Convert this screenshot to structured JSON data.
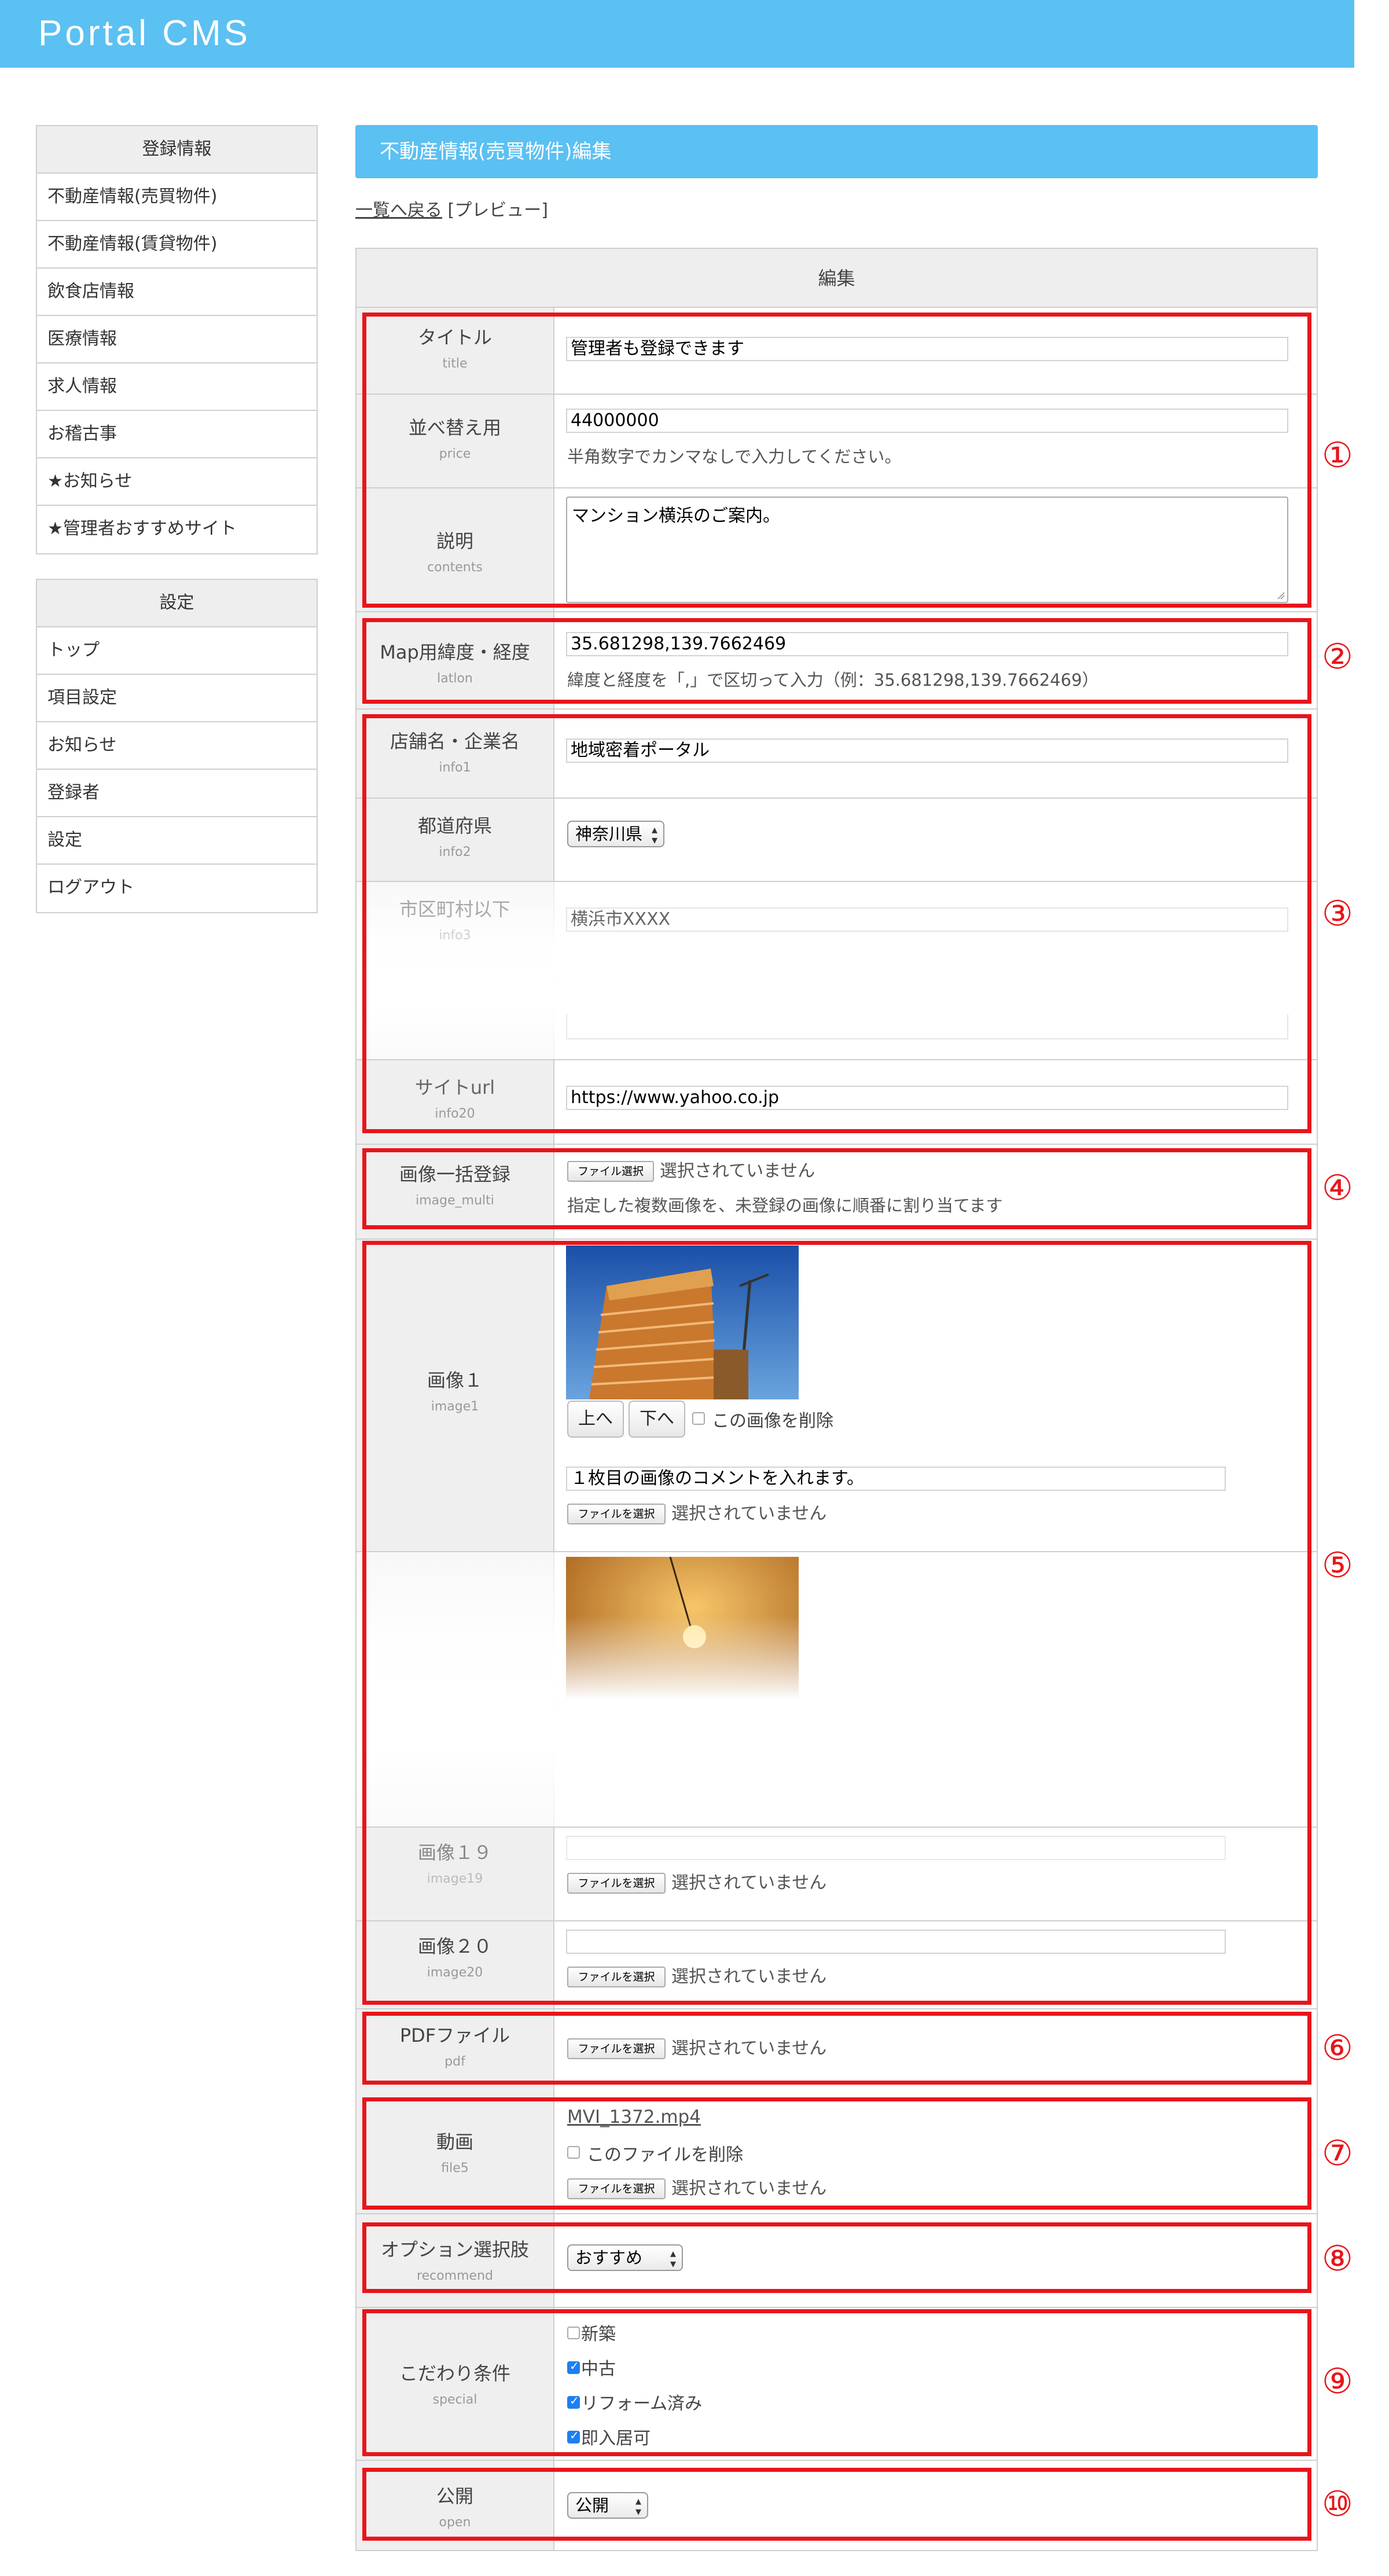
{
  "app": {
    "brand": "Portal CMS"
  },
  "sidebar": {
    "registration": {
      "title": "登録情報",
      "items": [
        "不動産情報(売買物件)",
        "不動産情報(賃貸物件)",
        "飲食店情報",
        "医療情報",
        "求人情報",
        "お稽古事",
        "★お知らせ",
        "★管理者おすすめサイト"
      ]
    },
    "settings": {
      "title": "設定",
      "items": [
        "トップ",
        "項目設定",
        "お知らせ",
        "登録者",
        "設定",
        "ログアウト"
      ]
    }
  },
  "page": {
    "header": "不動産情報(売買物件)編集",
    "back_link": "一覧へ戻る",
    "preview_link": "[プレビュー]",
    "form_title": "編集"
  },
  "fields": {
    "title": {
      "label": "タイトル",
      "key": "title",
      "value": "管理者も登録できます"
    },
    "price": {
      "label": "並べ替え用",
      "key": "price",
      "value": "44000000",
      "hint": "半角数字でカンマなしで入力してください。"
    },
    "contents": {
      "label": "説明",
      "key": "contents",
      "value": "マンション横浜のご案内。"
    },
    "latlon": {
      "label": "Map用緯度・経度",
      "key": "latlon",
      "value": "35.681298,139.7662469",
      "hint": "緯度と経度を「,」で区切って入力（例：35.681298,139.7662469）"
    },
    "info1": {
      "label": "店舗名・企業名",
      "key": "info1",
      "value": "地域密着ポータル"
    },
    "info2": {
      "label": "都道府県",
      "key": "info2",
      "value": "神奈川県"
    },
    "info3": {
      "label": "市区町村以下",
      "key": "info3",
      "value": "横浜市XXXX"
    },
    "info20": {
      "label": "サイトurl",
      "key": "info20",
      "value": "https://www.yahoo.co.jp"
    },
    "image_multi": {
      "label": "画像一括登録",
      "key": "image_multi",
      "hint": "指定した複数画像を、未登録の画像に順番に割り当てます"
    },
    "image1": {
      "label": "画像１",
      "key": "image1",
      "up": "上へ",
      "down": "下へ",
      "delete_label": "この画像を削除",
      "comment": "１枚目の画像のコメントを入れます。"
    },
    "image19": {
      "label": "画像１９",
      "key": "image19"
    },
    "image20": {
      "label": "画像２０",
      "key": "image20"
    },
    "pdf": {
      "label": "PDFファイル",
      "key": "pdf"
    },
    "file5": {
      "label": "動画",
      "key": "file5",
      "filename": "MVI_1372.mp4",
      "delete_label": "このファイルを削除"
    },
    "recommend": {
      "label": "オプション選択肢",
      "key": "recommend",
      "value": "おすすめ"
    },
    "special": {
      "label": "こだわり条件",
      "key": "special",
      "options": [
        {
          "label": "新築",
          "checked": false
        },
        {
          "label": "中古",
          "checked": true
        },
        {
          "label": "リフォーム済み",
          "checked": true
        },
        {
          "label": "即入居可",
          "checked": true
        }
      ]
    },
    "open": {
      "label": "公開",
      "key": "open",
      "value": "公開"
    }
  },
  "file_input": {
    "button": "ファイル選択",
    "button_alt": "ファイルを選択",
    "no_file": "選択されていません"
  },
  "annotations": [
    "①",
    "②",
    "③",
    "④",
    "⑤",
    "⑥",
    "⑦",
    "⑧",
    "⑨",
    "⑩"
  ],
  "colors": {
    "accent": "#5bc0f2",
    "annotation": "#e8151b",
    "checkbox": "#1e7ff0"
  }
}
